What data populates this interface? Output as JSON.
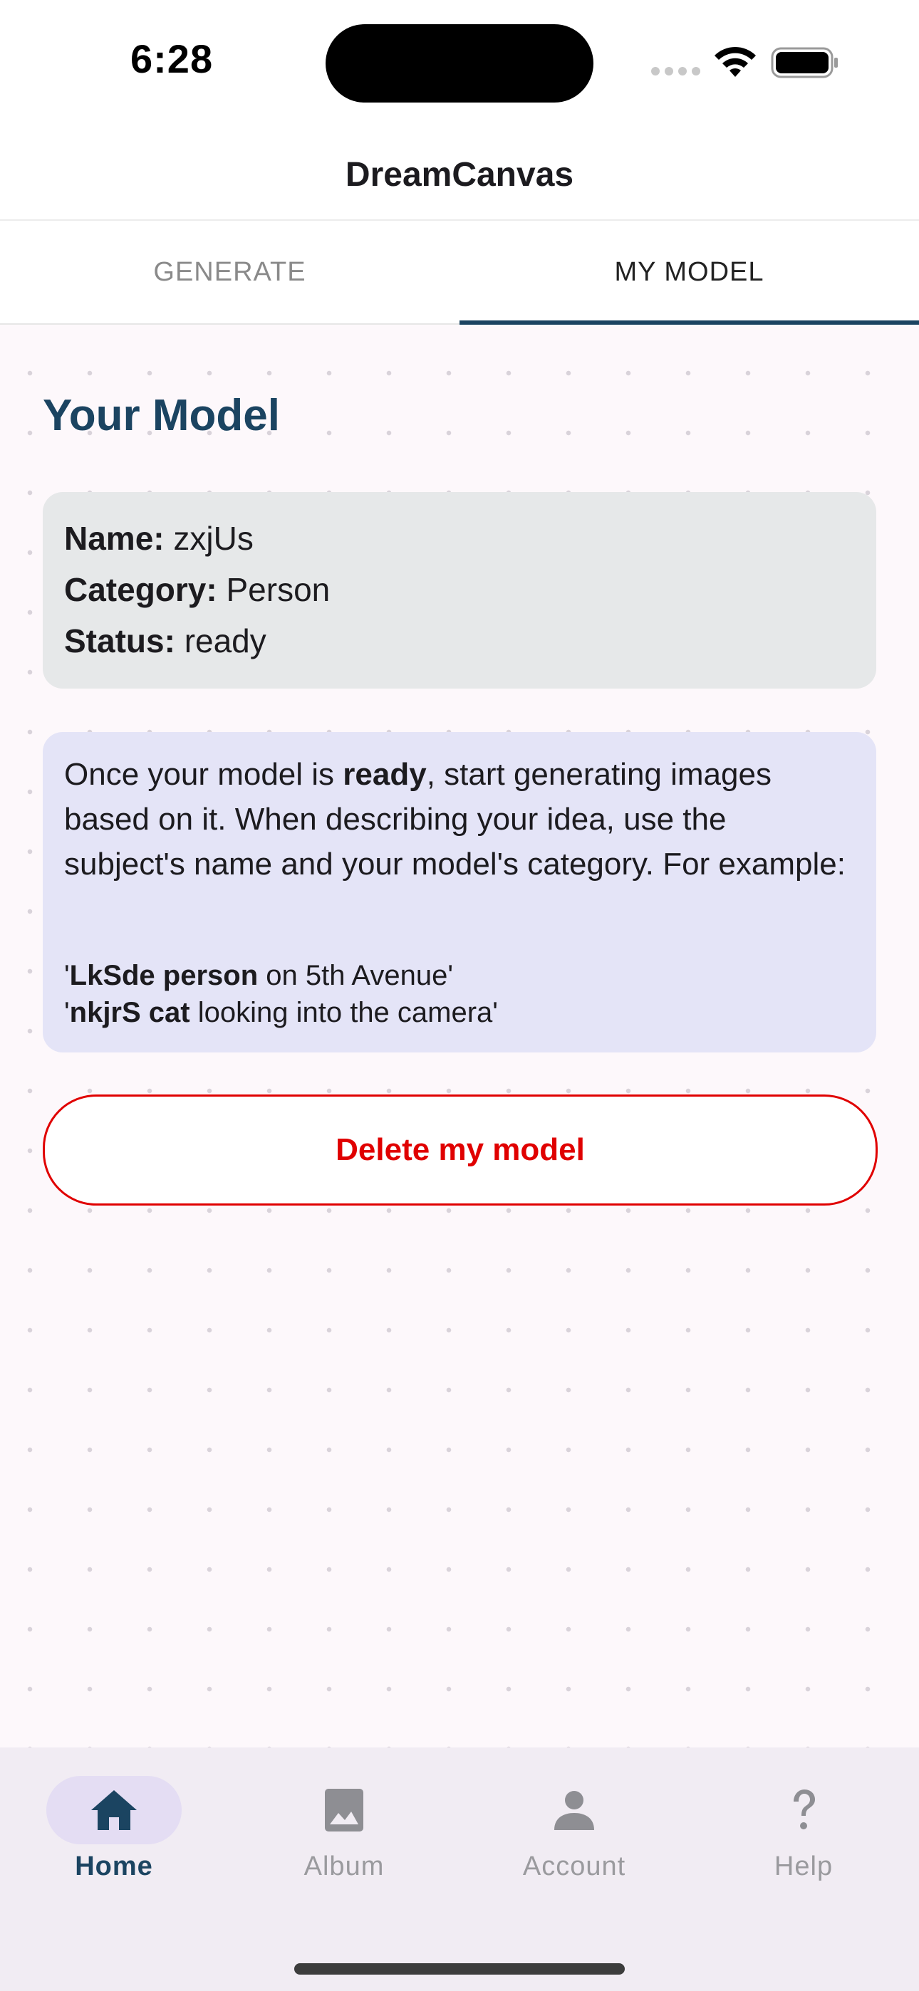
{
  "status_bar": {
    "time": "6:28",
    "icons": [
      "cellular-dots-icon",
      "wifi-icon",
      "battery-icon"
    ]
  },
  "header": {
    "title": "DreamCanvas"
  },
  "tabs": [
    {
      "label": "GENERATE",
      "selected": false
    },
    {
      "label": "MY MODEL",
      "selected": true
    }
  ],
  "model_section": {
    "title": "Your Model",
    "name_label": "Name:",
    "name_value": "zxjUs",
    "category_label": "Category:",
    "category_value": "Person",
    "status_label": "Status:",
    "status_value": "ready"
  },
  "tip": {
    "text_before": "Once your model is ",
    "text_bold": "ready",
    "text_after": ", start generating images based on it. When describing your idea, use the subject's name and your model's category. For example:",
    "examples": [
      {
        "open": "'",
        "bold": "LkSde person",
        "rest": " on 5th Avenue'"
      },
      {
        "open": "'",
        "bold": "nkjrS cat",
        "rest": " looking into the camera'"
      }
    ]
  },
  "delete_button": {
    "label": "Delete my model"
  },
  "bottom_nav": [
    {
      "label": "Home",
      "icon": "home-icon",
      "active": true
    },
    {
      "label": "Album",
      "icon": "image-icon",
      "active": false
    },
    {
      "label": "Account",
      "icon": "person-icon",
      "active": false
    },
    {
      "label": "Help",
      "icon": "question-mark-icon",
      "active": false
    }
  ],
  "colors": {
    "primary": "#1b4461",
    "danger": "#e00000",
    "info_card_bg": "#e6e8e9",
    "tip_card_bg": "#e4e4f7",
    "nav_bg": "#f1ecf3",
    "nav_active_pill": "#e4ddf3"
  }
}
